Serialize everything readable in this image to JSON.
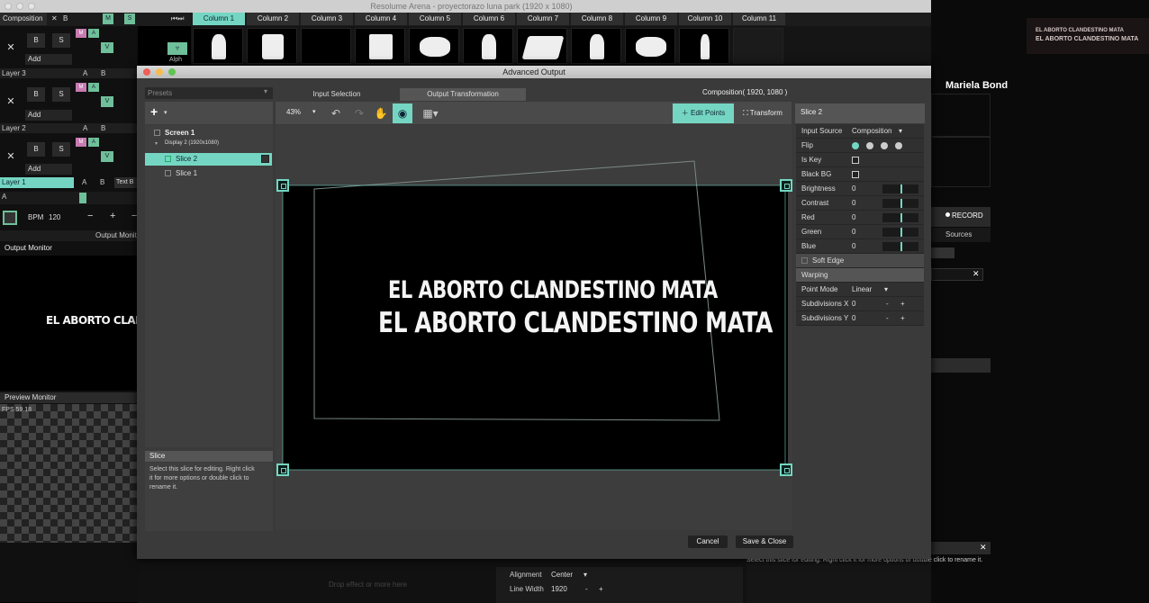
{
  "window": {
    "title": "Resolume Arena - proyectorazo luna park (1920 x 1080)"
  },
  "composition": {
    "label": "Composition",
    "x_label": "✕",
    "b_label": "B",
    "m_label": "M",
    "s_label": "S",
    "alph_label": "Alph"
  },
  "columns": [
    "Column 1",
    "Column 2",
    "Column 3",
    "Column 4",
    "Column 5",
    "Column 6",
    "Column 7",
    "Column 8",
    "Column 9",
    "Column 10",
    "Column 11"
  ],
  "layers": [
    {
      "name": "Layer 3",
      "add": "Add",
      "a": "A",
      "b": "B"
    },
    {
      "name": "Layer 2",
      "add": "Add",
      "a": "A",
      "b": "B"
    },
    {
      "name": "Layer 1",
      "add": "Add",
      "a": "A",
      "b": "B"
    }
  ],
  "layer_buttons": {
    "b": "B",
    "s": "S",
    "m": "M",
    "a_tag": "A",
    "v": "V",
    "x": "✕"
  },
  "text_block": "Text B",
  "a_row": "A",
  "bpm": {
    "label": "BPM",
    "value": "120",
    "minus": "−",
    "plus": "+"
  },
  "output_monitor": {
    "tab": "Output Monit",
    "label": "Output Monitor",
    "preview_text": "EL ABORTO CLANDE"
  },
  "preview_monitor": {
    "label": "Preview Monitor",
    "fps": "FPS 59.18"
  },
  "dialog": {
    "title": "Advanced Output",
    "presets": "Presets",
    "tabs": {
      "input": "Input Selection",
      "output": "Output Transformation"
    },
    "composition_info": "Composition( 1920, 1080 )",
    "zoom": "43%",
    "edit_points": "Edit Points",
    "transform": "Transform",
    "tree": {
      "screen": "Screen 1",
      "display": "Display 2 (1920x1080)",
      "slices": [
        "Slice 2",
        "Slice 1"
      ]
    },
    "help": {
      "title": "Slice",
      "text": "Select this slice for editing. Right click it for more options or double click to rename it."
    },
    "canvas_text": {
      "line1": "EL ABORTO CLANDESTINO MATA",
      "line2": "EL ABORTO CLANDESTINO MATA"
    },
    "props": {
      "title": "Slice 2",
      "input_source_label": "Input Source",
      "input_source_value": "Composition",
      "flip_label": "Flip",
      "is_key": "Is Key",
      "black_bg": "Black BG",
      "sliders": [
        {
          "label": "Brightness",
          "value": "0"
        },
        {
          "label": "Contrast",
          "value": "0"
        },
        {
          "label": "Red",
          "value": "0"
        },
        {
          "label": "Green",
          "value": "0"
        },
        {
          "label": "Blue",
          "value": "0"
        }
      ],
      "soft_edge": "Soft Edge",
      "warping": "Warping",
      "point_mode_label": "Point Mode",
      "point_mode_value": "Linear",
      "subdiv_x_label": "Subdivisions X",
      "subdiv_x_value": "0",
      "subdiv_y_label": "Subdivisions Y",
      "subdiv_y_value": "0",
      "minus": "-",
      "plus": "+"
    },
    "cancel": "Cancel",
    "save_close": "Save & Close"
  },
  "bottom": {
    "alignment_label": "Alignment",
    "alignment_value": "Center",
    "line_width_label": "Line Width",
    "line_width_value": "1920",
    "minus": "-",
    "plus": "+",
    "drop_hint": "Drop effect or more here",
    "help_repeat": "Select this slice for editing. Right click it for more options or double click to rename it."
  },
  "right": {
    "user": "Mariela Bond",
    "cam_text1": "EL ABORTO CLANDESTINO MATA",
    "cam_text2": "EL ABORTO CLANDESTINO MATA",
    "record": "RECORD",
    "sources": "Sources",
    "close": "✕"
  },
  "colors": {
    "accent": "#74d6c2",
    "pink": "#c77bb0",
    "green": "#6fbf9a"
  }
}
